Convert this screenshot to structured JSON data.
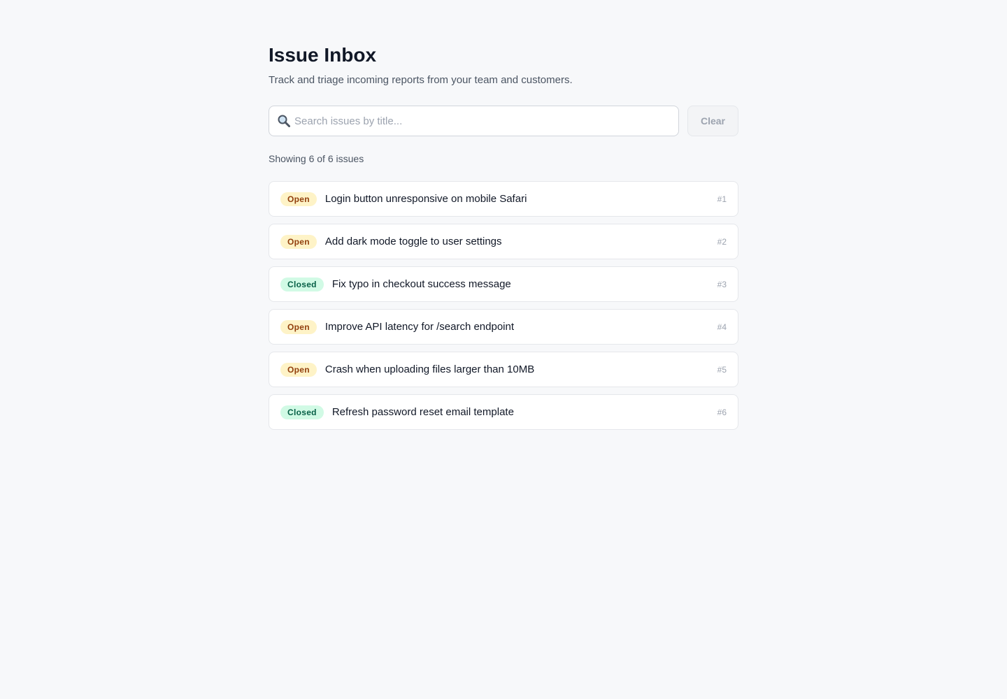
{
  "header": {
    "title": "Issue Inbox",
    "subtitle": "Track and triage incoming reports from your team and customers."
  },
  "search": {
    "value": "",
    "placeholder": "Search issues by title...",
    "icon": "search-icon",
    "clear_label": "Clear"
  },
  "summary": {
    "count_text": "Showing 6 of 6 issues"
  },
  "colors": {
    "open_bg": "#fef3c7",
    "open_text": "#92400e",
    "closed_bg": "#d1fae5",
    "closed_text": "#065f46"
  },
  "issues": [
    {
      "status": "Open",
      "title": "Login button unresponsive on mobile Safari",
      "number": "#1"
    },
    {
      "status": "Open",
      "title": "Add dark mode toggle to user settings",
      "number": "#2"
    },
    {
      "status": "Closed",
      "title": "Fix typo in checkout success message",
      "number": "#3"
    },
    {
      "status": "Open",
      "title": "Improve API latency for /search endpoint",
      "number": "#4"
    },
    {
      "status": "Open",
      "title": "Crash when uploading files larger than 10MB",
      "number": "#5"
    },
    {
      "status": "Closed",
      "title": "Refresh password reset email template",
      "number": "#6"
    }
  ]
}
